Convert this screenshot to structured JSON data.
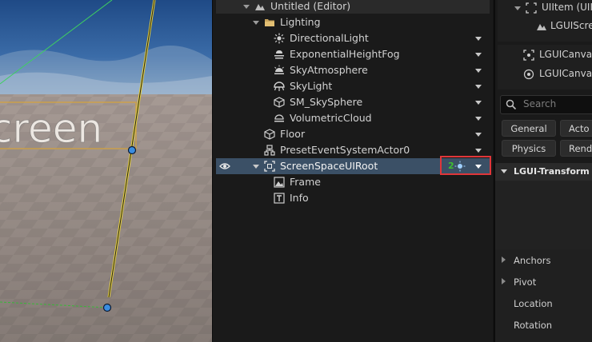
{
  "viewport": {
    "canvas_text": "creen"
  },
  "outliner": {
    "rows": [
      {
        "label": "Untitled (Editor)",
        "icon": "level-icon"
      },
      {
        "label": "Lighting",
        "icon": "folder-icon"
      },
      {
        "label": "DirectionalLight",
        "icon": "directional-light-icon"
      },
      {
        "label": "ExponentialHeightFog",
        "icon": "height-fog-icon"
      },
      {
        "label": "SkyAtmosphere",
        "icon": "sky-atmosphere-icon"
      },
      {
        "label": "SkyLight",
        "icon": "skylight-icon"
      },
      {
        "label": "SM_SkySphere",
        "icon": "static-mesh-icon"
      },
      {
        "label": "VolumetricCloud",
        "icon": "cloud-icon"
      },
      {
        "label": "Floor",
        "icon": "static-mesh-icon"
      },
      {
        "label": "PresetEventSystemActor0",
        "icon": "actor-icon"
      },
      {
        "label": "ScreenSpaceUIRoot",
        "icon": "ui-root-icon"
      },
      {
        "label": "Frame",
        "icon": "image-icon"
      },
      {
        "label": "Info",
        "icon": "text-icon"
      }
    ],
    "selected_badge": "2"
  },
  "details": {
    "component_tree": [
      {
        "label": "UIItem (UII"
      },
      {
        "label": "LGUIScre"
      },
      {
        "label": "LGUICanva"
      },
      {
        "label": "LGUICanva"
      }
    ],
    "search_placeholder": "Search",
    "filter_buttons": [
      "General",
      "Acto",
      "Physics",
      "Rend"
    ],
    "section": "LGUI-Transform",
    "props": [
      "Anchors",
      "Pivot",
      "Location",
      "Rotation"
    ]
  },
  "colors": {
    "selection": "#3b5066",
    "highlight_box": "#e0363a",
    "accent_green": "#3fbf2f"
  }
}
